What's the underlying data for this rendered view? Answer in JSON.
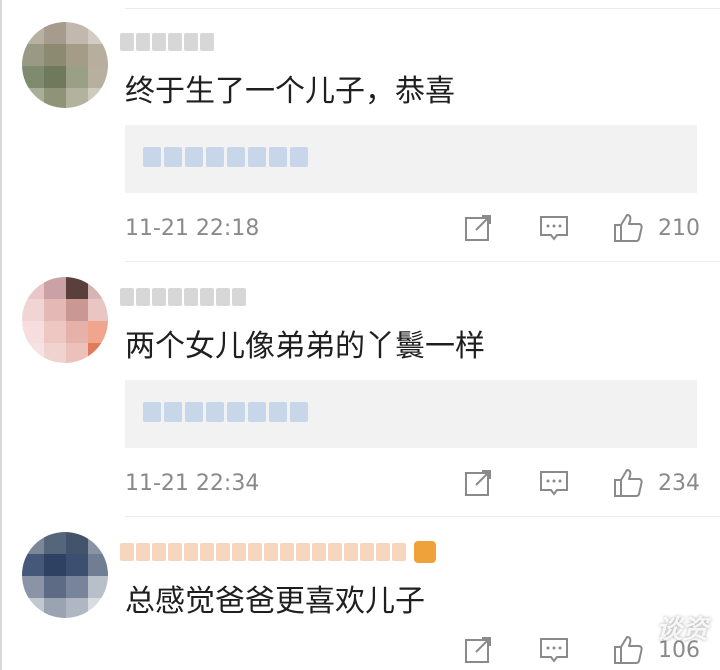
{
  "comments": [
    {
      "text": "终于生了一个儿子，恭喜",
      "timestamp": "11-21 22:18",
      "likes": "210"
    },
    {
      "text": "两个女儿像弟弟的丫鬟一样",
      "timestamp": "11-21 22:34",
      "likes": "234"
    },
    {
      "text": "总感觉爸爸更喜欢儿子",
      "likes": "106"
    }
  ],
  "watermark": "谈资",
  "icons": {
    "share": "share-icon",
    "reply": "reply-icon",
    "like": "thumbs-up-icon"
  },
  "colors": {
    "text": "#1f1f1f",
    "meta": "#8a8a8a",
    "quote_bg": "#f2f2f2",
    "quote_link": "#c8d6ea"
  }
}
